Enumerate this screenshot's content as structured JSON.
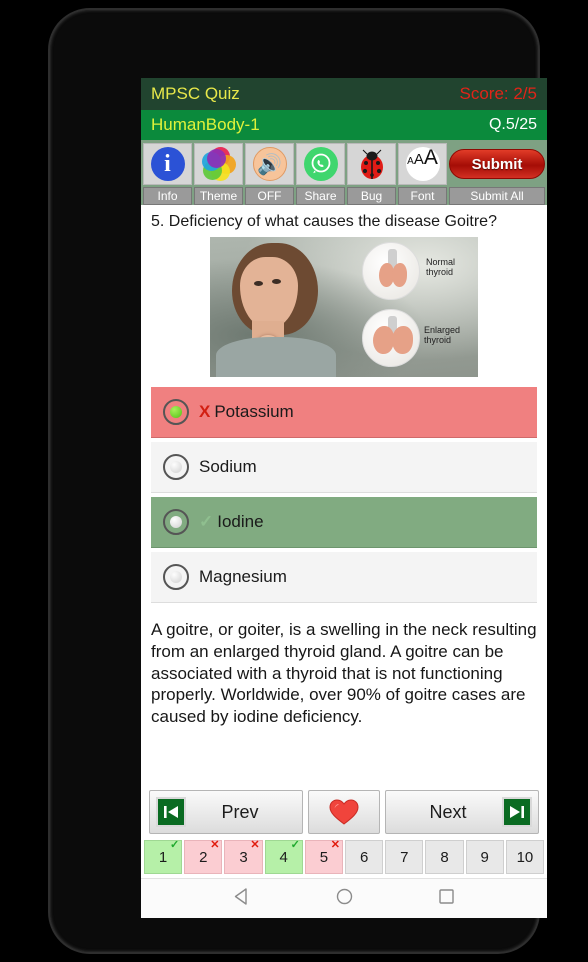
{
  "app": {
    "title": "MPSC Quiz",
    "score": "Score: 2/5",
    "topic": "HumanBody-1",
    "question_counter": "Q.5/25",
    "colors": {
      "title_bar_bg": "#21442f",
      "title_text": "#e8e84a",
      "score_text": "#e02418",
      "topic_bar_bg": "#0b8a3c",
      "topic_text": "#dff23a",
      "counter_text": "#ffffff",
      "toolbar_bg": "#7ea183",
      "wrong_option_bg": "#f08080",
      "correct_option_bg": "#81ab81",
      "submit_red": "#a50d06"
    }
  },
  "toolbar": {
    "items": [
      {
        "label": "Info",
        "icon": "info-icon"
      },
      {
        "label": "Theme",
        "icon": "theme-palette-icon"
      },
      {
        "label": "OFF",
        "icon": "speaker-off-icon"
      },
      {
        "label": "Share",
        "icon": "whatsapp-share-icon"
      },
      {
        "label": "Bug",
        "icon": "bug-report-icon"
      },
      {
        "label": "Font",
        "icon": "font-size-icon"
      },
      {
        "label": "Submit All",
        "icon": "submit-icon"
      }
    ],
    "submit_label": "Submit"
  },
  "question": {
    "text": "5. Deficiency of what causes the disease Goitre?",
    "image": {
      "alt": "woman-with-goitre-thyroid-diagram",
      "labels": [
        "Normal\nthyroid",
        "Enlarged\nthyroid"
      ],
      "label_normal_line1": "Normal",
      "label_normal_line2": "thyroid",
      "label_enlarged_line1": "Enlarged",
      "label_enlarged_line2": "thyroid"
    },
    "options": [
      {
        "label": "Potassium",
        "state": "wrong",
        "selected": true,
        "mark": "X"
      },
      {
        "label": "Sodium",
        "state": "neutral",
        "selected": false,
        "mark": ""
      },
      {
        "label": "Iodine",
        "state": "correct",
        "selected": false,
        "mark": "✓"
      },
      {
        "label": "Magnesium",
        "state": "neutral",
        "selected": false,
        "mark": ""
      }
    ],
    "explanation": "A goitre, or goiter, is a swelling in the neck resulting from an enlarged thyroid gland. A goitre can be associated with a thyroid that is not functioning properly. Worldwide, over 90% of goitre cases are caused by iodine deficiency."
  },
  "nav": {
    "prev_label": "Prev",
    "next_label": "Next",
    "favorite_icon": "heart-icon",
    "prev_icon": "skip-previous-icon",
    "next_icon": "skip-next-icon"
  },
  "question_strip": [
    {
      "number": "1",
      "state": "correct",
      "badge": "✓"
    },
    {
      "number": "2",
      "state": "wrong",
      "badge": "✕"
    },
    {
      "number": "3",
      "state": "wrong",
      "badge": "✕"
    },
    {
      "number": "4",
      "state": "correct",
      "badge": "✓"
    },
    {
      "number": "5",
      "state": "wrong",
      "badge": "✕"
    },
    {
      "number": "6",
      "state": "none",
      "badge": ""
    },
    {
      "number": "7",
      "state": "none",
      "badge": ""
    },
    {
      "number": "8",
      "state": "none",
      "badge": ""
    },
    {
      "number": "9",
      "state": "none",
      "badge": ""
    },
    {
      "number": "10",
      "state": "none",
      "badge": ""
    }
  ],
  "android_nav": {
    "back": "back-triangle-icon",
    "home": "home-circle-icon",
    "recents": "recents-square-icon"
  }
}
